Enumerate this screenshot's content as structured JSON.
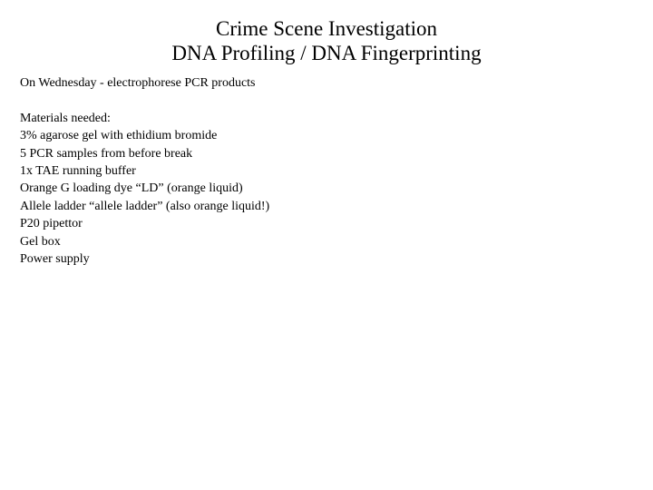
{
  "title": {
    "line1": "Crime Scene Investigation",
    "line2": "DNA Profiling / DNA Fingerprinting"
  },
  "intro": "On Wednesday - electrophorese PCR products",
  "materials": {
    "heading": "Materials needed:",
    "items": [
      "3% agarose gel with ethidium bromide",
      "5 PCR samples from before break",
      "1x TAE running buffer",
      "Orange G loading dye “LD” (orange liquid)",
      "Allele ladder “allele ladder” (also orange liquid!)",
      "P20 pipettor",
      "Gel box",
      "Power supply"
    ]
  }
}
